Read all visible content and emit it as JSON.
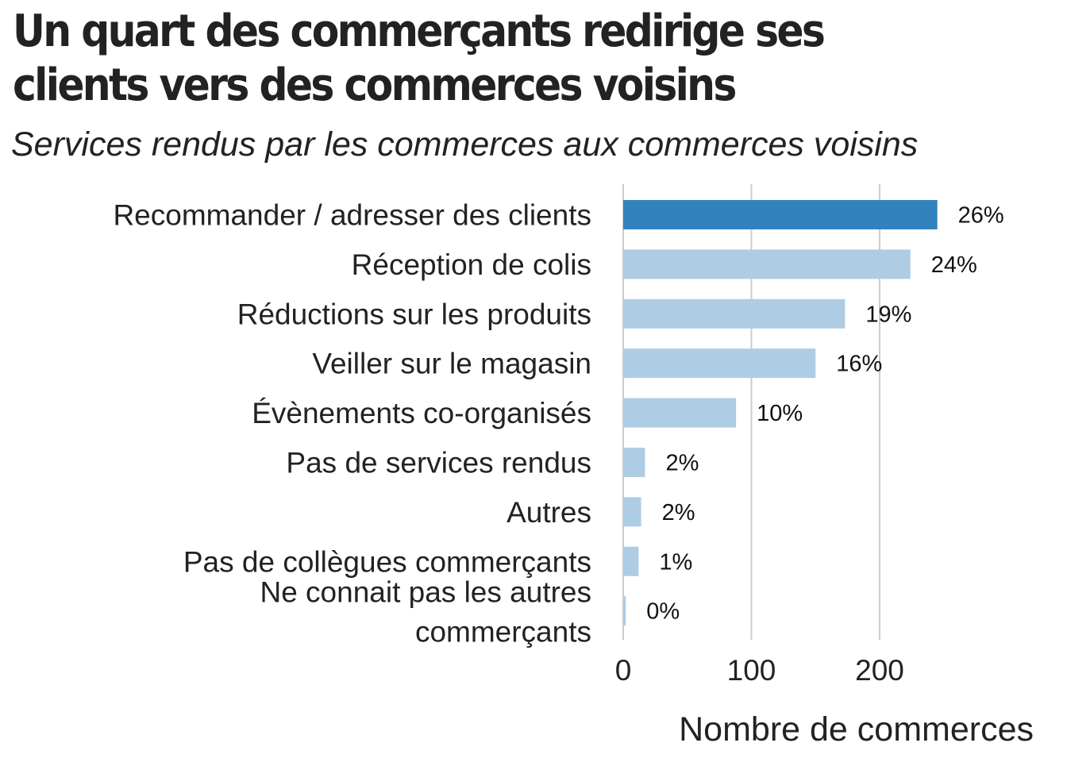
{
  "title": "Un quart des commerçants redirige ses clients vers des commerces voisins",
  "subtitle": "Services rendus par les commerces aux commerces voisins",
  "chart_data": {
    "type": "bar",
    "orientation": "horizontal",
    "categories": [
      "Recommander / adresser des clients",
      "Réception de colis",
      "Réductions sur les produits",
      "Veiller sur le magasin",
      "Évènements co-organisés",
      "Pas de services rendus",
      "Autres",
      "Pas de collègues commerçants",
      [
        "Ne connait pas les autres",
        "commerçants"
      ]
    ],
    "values": [
      245,
      224,
      173,
      150,
      88,
      17,
      14,
      12,
      2
    ],
    "data_labels": [
      "26%",
      "24%",
      "19%",
      "16%",
      "10%",
      "2%",
      "2%",
      "1%",
      "0%"
    ],
    "highlight_index": 0,
    "colors": {
      "highlight": "#3182bd",
      "default": "#aecde4",
      "grid": "#cccccc"
    },
    "xlabel": "Nombre de commerces",
    "xticks": [
      0,
      100,
      200
    ],
    "xlim": [
      0,
      300
    ],
    "grid": true
  }
}
